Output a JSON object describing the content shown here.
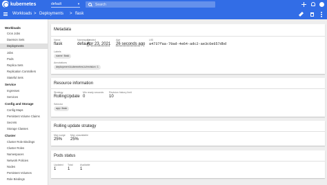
{
  "header": {
    "brand": "kubernetes",
    "namespace_value": "default",
    "search_placeholder": "Search"
  },
  "breadcrumb": {
    "items": [
      "Workloads",
      "Deployments",
      "flask"
    ],
    "separator": ">"
  },
  "sidebar": {
    "groups": [
      {
        "title": "Workloads",
        "items": [
          "Cron Jobs",
          "Daemon Sets",
          "Deployments",
          "Jobs",
          "Pods",
          "Replica Sets",
          "Replication Controllers",
          "Stateful Sets"
        ]
      },
      {
        "title": "Service",
        "items": [
          "Ingresses",
          "Services"
        ]
      },
      {
        "title": "Config and Storage",
        "items": [
          "Config Maps",
          "Persistent Volume Claims",
          "Secrets",
          "Storage Classes"
        ]
      },
      {
        "title": "Cluster",
        "items": [
          "Cluster Role Bindings",
          "Cluster Roles",
          "Namespaces",
          "Network Policies",
          "Nodes",
          "Persistent Volumes",
          "Role Bindings"
        ]
      }
    ],
    "active_item": "Deployments"
  },
  "metadata": {
    "title": "Metadata",
    "fields": [
      {
        "label": "Name",
        "value": "flask"
      },
      {
        "label": "Namespace",
        "value": "default"
      },
      {
        "label": "Created",
        "value": "Apr 23, 2021"
      },
      {
        "label": "Age",
        "value": "26 seconds ago"
      },
      {
        "label": "UID",
        "value": "a4737faa-79ad-4e64-adc2-ae3c6e657dbd"
      }
    ],
    "labels_label": "Labels",
    "labels": [
      "name: flask"
    ],
    "annotations_label": "Annotations",
    "annotations": [
      "deployment.kubernetes.io/revision: 1"
    ]
  },
  "resource_information": {
    "title": "Resource information",
    "fields": [
      {
        "label": "Strategy",
        "value": "RollingUpdate"
      },
      {
        "label": "Min ready seconds",
        "value": "0"
      },
      {
        "label": "Revision history limit",
        "value": "10"
      }
    ],
    "selector_label": "Selector",
    "selector": [
      "app: flask"
    ]
  },
  "rolling_update": {
    "title": "Rolling update strategy",
    "fields": [
      {
        "label": "Max surge",
        "value": "25%"
      },
      {
        "label": "Max unavailable",
        "value": "25%"
      }
    ]
  },
  "pods_status": {
    "title": "Pods status",
    "fields": [
      {
        "label": "Updated",
        "value": "1"
      },
      {
        "label": "Total",
        "value": "1"
      },
      {
        "label": "Available",
        "value": "1"
      }
    ]
  },
  "colors": {
    "primary": "#326de6",
    "background": "#eeeeee",
    "card": "#ffffff",
    "active_nav": "#e0e0e0"
  },
  "icons": [
    "kubernetes-logo-icon",
    "chevron-down-icon",
    "search-icon",
    "plus-icon",
    "bell-icon",
    "account-icon",
    "menu-icon",
    "edit-icon",
    "trash-icon",
    "more-vert-icon"
  ]
}
